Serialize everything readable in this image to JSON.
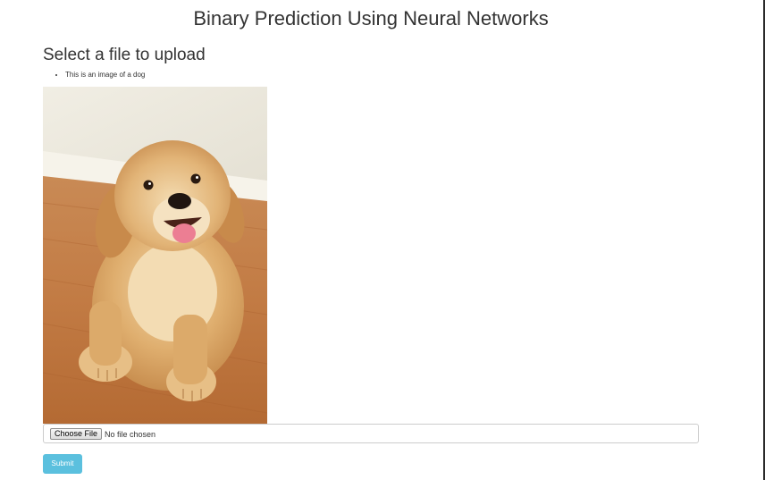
{
  "page": {
    "title": "Binary Prediction Using Neural Networks"
  },
  "upload": {
    "heading": "Select a file to upload",
    "results": [
      "This is an image of a dog"
    ],
    "choose_file_label": "Choose File",
    "file_status": "No file chosen",
    "submit_label": "Submit"
  },
  "preview_image": {
    "subject": "golden retriever puppy lying on a wooden floor"
  },
  "colors": {
    "submit_button": "#5bc0de",
    "text": "#333333"
  }
}
